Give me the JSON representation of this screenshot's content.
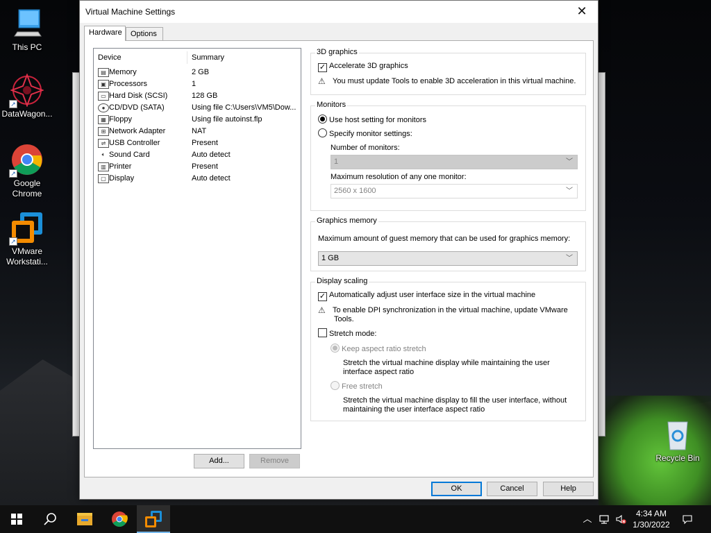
{
  "desktop": {
    "icons": [
      {
        "label": "This PC"
      },
      {
        "label": "DataWagon..."
      },
      {
        "label": "Google Chrome"
      },
      {
        "label": "VMware Workstati..."
      },
      {
        "label": "Recycle Bin"
      }
    ]
  },
  "dialog": {
    "title": "Virtual Machine Settings",
    "close_glyph": "✕",
    "tabs": [
      "Hardware",
      "Options"
    ],
    "device_list": {
      "col_device": "Device",
      "col_summary": "Summary",
      "devices": [
        {
          "icon": "memory-icon",
          "name": "Memory",
          "summary": "2 GB"
        },
        {
          "icon": "processor-icon",
          "name": "Processors",
          "summary": "1"
        },
        {
          "icon": "hard-disk-icon",
          "name": "Hard Disk (SCSI)",
          "summary": "128 GB"
        },
        {
          "icon": "cd-dvd-icon",
          "name": "CD/DVD (SATA)",
          "summary": "Using file C:\\Users\\VM5\\Dow..."
        },
        {
          "icon": "floppy-icon",
          "name": "Floppy",
          "summary": "Using file autoinst.flp"
        },
        {
          "icon": "network-adapter-icon",
          "name": "Network Adapter",
          "summary": "NAT"
        },
        {
          "icon": "usb-controller-icon",
          "name": "USB Controller",
          "summary": "Present"
        },
        {
          "icon": "sound-card-icon",
          "name": "Sound Card",
          "summary": "Auto detect"
        },
        {
          "icon": "printer-icon",
          "name": "Printer",
          "summary": "Present"
        },
        {
          "icon": "display-icon",
          "name": "Display",
          "summary": "Auto detect"
        }
      ]
    },
    "buttons": {
      "add": "Add...",
      "remove": "Remove",
      "ok": "OK",
      "cancel": "Cancel",
      "help": "Help"
    },
    "graphics3d": {
      "legend": "3D graphics",
      "accelerate_label": "Accelerate 3D graphics",
      "accelerate_checked": true,
      "warning": "You must update Tools to enable 3D acceleration in this virtual machine."
    },
    "monitors": {
      "legend": "Monitors",
      "use_host_label": "Use host setting for monitors",
      "specify_label": "Specify monitor settings:",
      "selected": "use_host",
      "num_monitors_label": "Number of monitors:",
      "num_monitors_value": "1",
      "max_res_label": "Maximum resolution of any one monitor:",
      "max_res_value": "2560 x 1600"
    },
    "graphics_memory": {
      "legend": "Graphics memory",
      "description": "Maximum amount of guest memory that can be used for graphics memory:",
      "value": "1 GB"
    },
    "display_scaling": {
      "legend": "Display scaling",
      "auto_adjust_label": "Automatically adjust user interface size in the virtual machine",
      "auto_adjust_checked": true,
      "dpi_warning_line1": "To enable DPI synchronization in the virtual machine, update VMware",
      "dpi_warning_line2": "Tools.",
      "stretch_label": "Stretch mode:",
      "stretch_checked": false,
      "keep_aspect_label": "Keep aspect ratio stretch",
      "keep_aspect_desc_line1": "Stretch the virtual machine display while maintaining the user",
      "keep_aspect_desc_line2": "interface aspect ratio",
      "free_stretch_label": "Free stretch",
      "free_stretch_desc_line1": "Stretch the virtual machine display to fill the user interface, without",
      "free_stretch_desc_line2": "maintaining the user interface aspect ratio"
    }
  },
  "taskbar": {
    "time": "4:34 AM",
    "date": "1/30/2022",
    "pinned": [
      "windows-start",
      "search",
      "file-explorer",
      "google-chrome",
      "vmware-workstation"
    ]
  },
  "colors": {
    "accent": "#0078d7",
    "taskbar": "#101010",
    "dialog_bg": "#f0f0f0"
  }
}
